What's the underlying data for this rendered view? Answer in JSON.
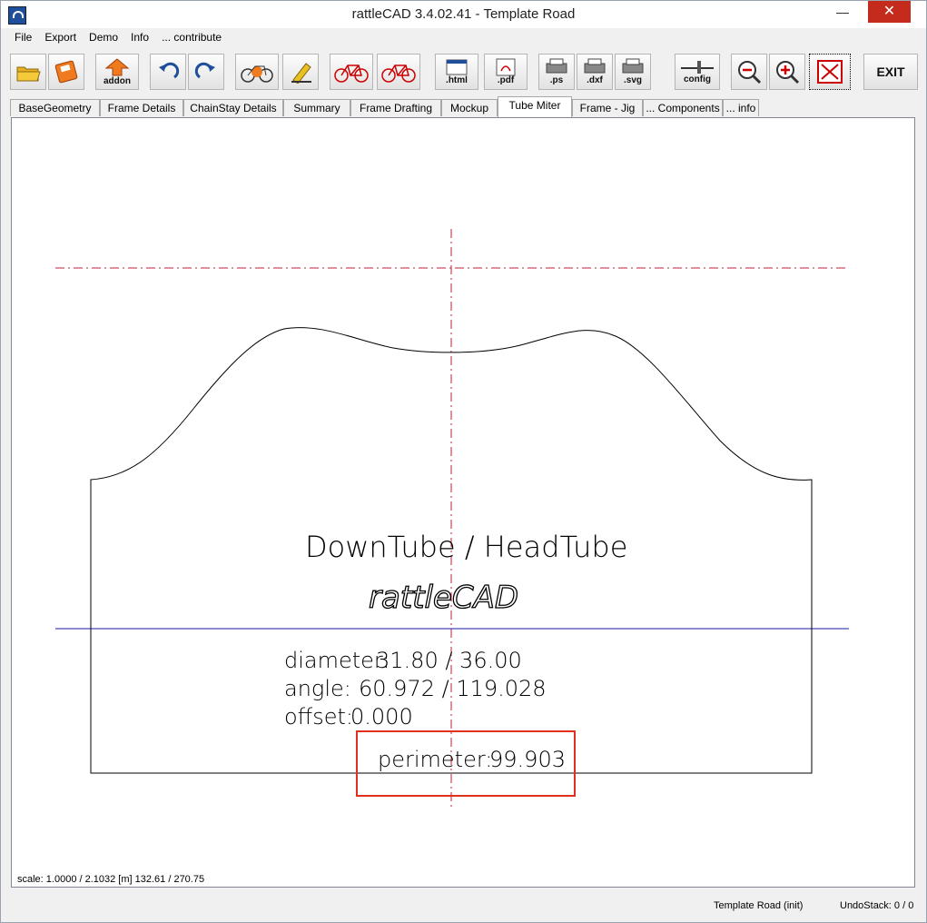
{
  "window": {
    "title": "rattleCAD  3.4.02.41 - Template Road",
    "min_glyph": "—",
    "max_glyph": "□",
    "close_glyph": "✕"
  },
  "menu": [
    "File",
    "Export",
    "Demo",
    "Info",
    "... contribute"
  ],
  "toolbar": {
    "addon_label": "addon",
    "html_label": ".html",
    "pdf_label": ".pdf",
    "ps_label": ".ps",
    "dxf_label": ".dxf",
    "svg_label": ".svg",
    "config_label": "config",
    "exit_label": "EXIT"
  },
  "tabs": [
    "BaseGeometry",
    "Frame Details",
    "ChainStay Details",
    "Summary",
    "Frame Drafting",
    "Mockup",
    "Tube Miter",
    "Frame - Jig",
    "... Components",
    "... info"
  ],
  "active_tab": "Tube Miter",
  "drawing": {
    "title": "DownTube / HeadTube",
    "logo": "rattleCAD",
    "diameter_label": "diameter:",
    "diameter_value": "31.80  /  36.00",
    "angle_label": "angle:",
    "angle_value": "60.972  /  119.028",
    "offset_label": "offset:",
    "offset_value": "0.000",
    "perimeter_label": "perimeter:",
    "perimeter_value": "99.903",
    "colors": {
      "centerline": "#c0203a",
      "baseline": "#1a1aaa",
      "highlight": "#e0301e"
    }
  },
  "canvas": {
    "scale_text": "scale: 1.0000 / 2.1032  [m]  132.61 / 270.75"
  },
  "status": {
    "template": "Template Road (init)",
    "undo": "UndoStack:  0 /  0"
  }
}
